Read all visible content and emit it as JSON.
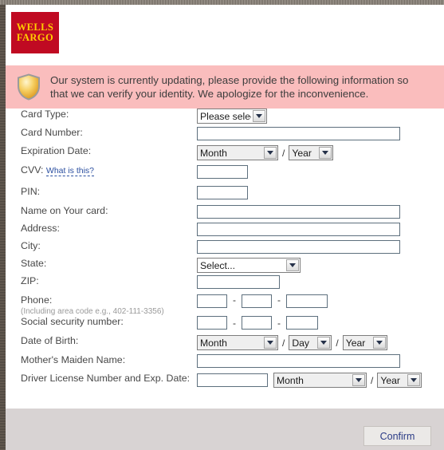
{
  "brand": {
    "logo_line1": "WELLS",
    "logo_line2": "FARGO",
    "logo_bg": "#c00a22",
    "logo_fg": "#ffcd00"
  },
  "banner": {
    "icon": "shield-icon",
    "message": "Our system is currently updating, please provide the following information so that we can verify your identity. We apologize for the inconvenience.",
    "bg": "#fabdbd",
    "text_color": "#3d3d3d"
  },
  "form": {
    "card_type": {
      "label": "Card Type:",
      "select_value": "Please select"
    },
    "card_number": {
      "label": "Card Number:",
      "value": ""
    },
    "expiration_date": {
      "label": "Expiration Date:",
      "month_value": "Month",
      "separator": "/",
      "year_value": "Year"
    },
    "cvv": {
      "label": "CVV:",
      "help_link": "What is this?",
      "value": ""
    },
    "pin": {
      "label": "PIN:",
      "value": ""
    },
    "name_on_card": {
      "label": "Name on Your card:",
      "value": ""
    },
    "address": {
      "label": "Address:",
      "value": ""
    },
    "city": {
      "label": "City:",
      "value": ""
    },
    "state": {
      "label": "State:",
      "select_value": "Select..."
    },
    "zip": {
      "label": "ZIP:",
      "value": ""
    },
    "phone": {
      "label": "Phone:",
      "hint": "(Including area code e.g., 402-111-3356)",
      "part1": "",
      "part2": "",
      "part3": "",
      "separator": "-"
    },
    "ssn": {
      "label": "Social security number:",
      "part1": "",
      "part2": "",
      "part3": "",
      "separator": "-"
    },
    "date_of_birth": {
      "label": "Date of Birth:",
      "month_value": "Month",
      "day_value": "Day",
      "year_value": "Year",
      "separator": "/"
    },
    "mothers_maiden_name": {
      "label": "Mother's Maiden Name:",
      "value": ""
    },
    "driver_license": {
      "label": "Driver License Number and Exp. Date:",
      "number_value": "",
      "month_value": "Month",
      "separator": "/",
      "year_value": "Year"
    }
  },
  "footer": {
    "confirm_label": "Confirm",
    "confirm_text_color": "#2b3b86",
    "bg": "#d8d3d3"
  }
}
